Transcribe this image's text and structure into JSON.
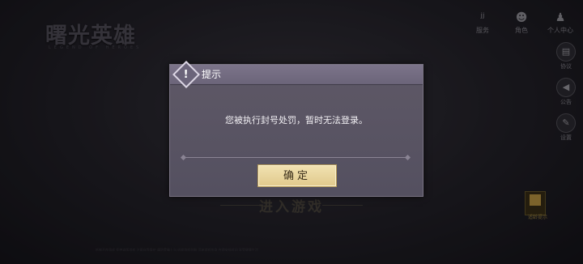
{
  "background": {
    "logo": "曙光英雄",
    "logo_sub": "LEGEND OF HEROES",
    "enter_game": "进入游戏",
    "footer": "抵制不良游戏 拒绝盗版游戏 注意自我保护 谨防受骗上当 适度游戏益脑 沉迷游戏伤身 合理安排时间 享受健康生活"
  },
  "topbar": {
    "items": [
      {
        "label": "服务",
        "icon": "service-icon"
      },
      {
        "label": "角色",
        "icon": "character-icon"
      },
      {
        "label": "个人中心",
        "icon": "profile-icon"
      }
    ]
  },
  "sidebar": {
    "items": [
      {
        "label": "协议",
        "icon": "document-icon"
      },
      {
        "label": "公告",
        "icon": "megaphone-icon"
      },
      {
        "label": "设置",
        "icon": "wrench-icon"
      }
    ]
  },
  "age_rating": {
    "label": "适龄提示",
    "icon": "age-rating-icon"
  },
  "dialog": {
    "title": "提示",
    "icon": "alert-icon",
    "icon_glyph": "!",
    "message": "您被执行封号处罚，暂时无法登录。",
    "confirm_label": "确定"
  },
  "colors": {
    "dialog_bg": "#5a5464",
    "header_bg": "#746c82",
    "confirm_bg": "#ead7a0",
    "confirm_text": "#3a2e1a"
  }
}
